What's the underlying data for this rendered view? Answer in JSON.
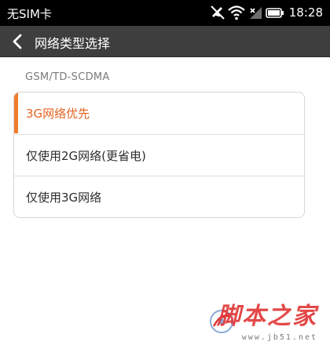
{
  "status_bar": {
    "carrier": "无SIM卡",
    "time": "18:28"
  },
  "header": {
    "title": "网络类型选择"
  },
  "section": {
    "label": "GSM/TD-SCDMA"
  },
  "options": [
    {
      "label": "3G网络优先",
      "selected": true
    },
    {
      "label": "仅使用2G网络(更省电)",
      "selected": false
    },
    {
      "label": "仅使用3G网络",
      "selected": false
    }
  ],
  "colors": {
    "accent": "#f07d2e",
    "selected_text": "#e4631f",
    "header_bg": "#3e3e3e"
  },
  "watermark": {
    "text": "脚本之家",
    "url": "www.jb51.net"
  }
}
